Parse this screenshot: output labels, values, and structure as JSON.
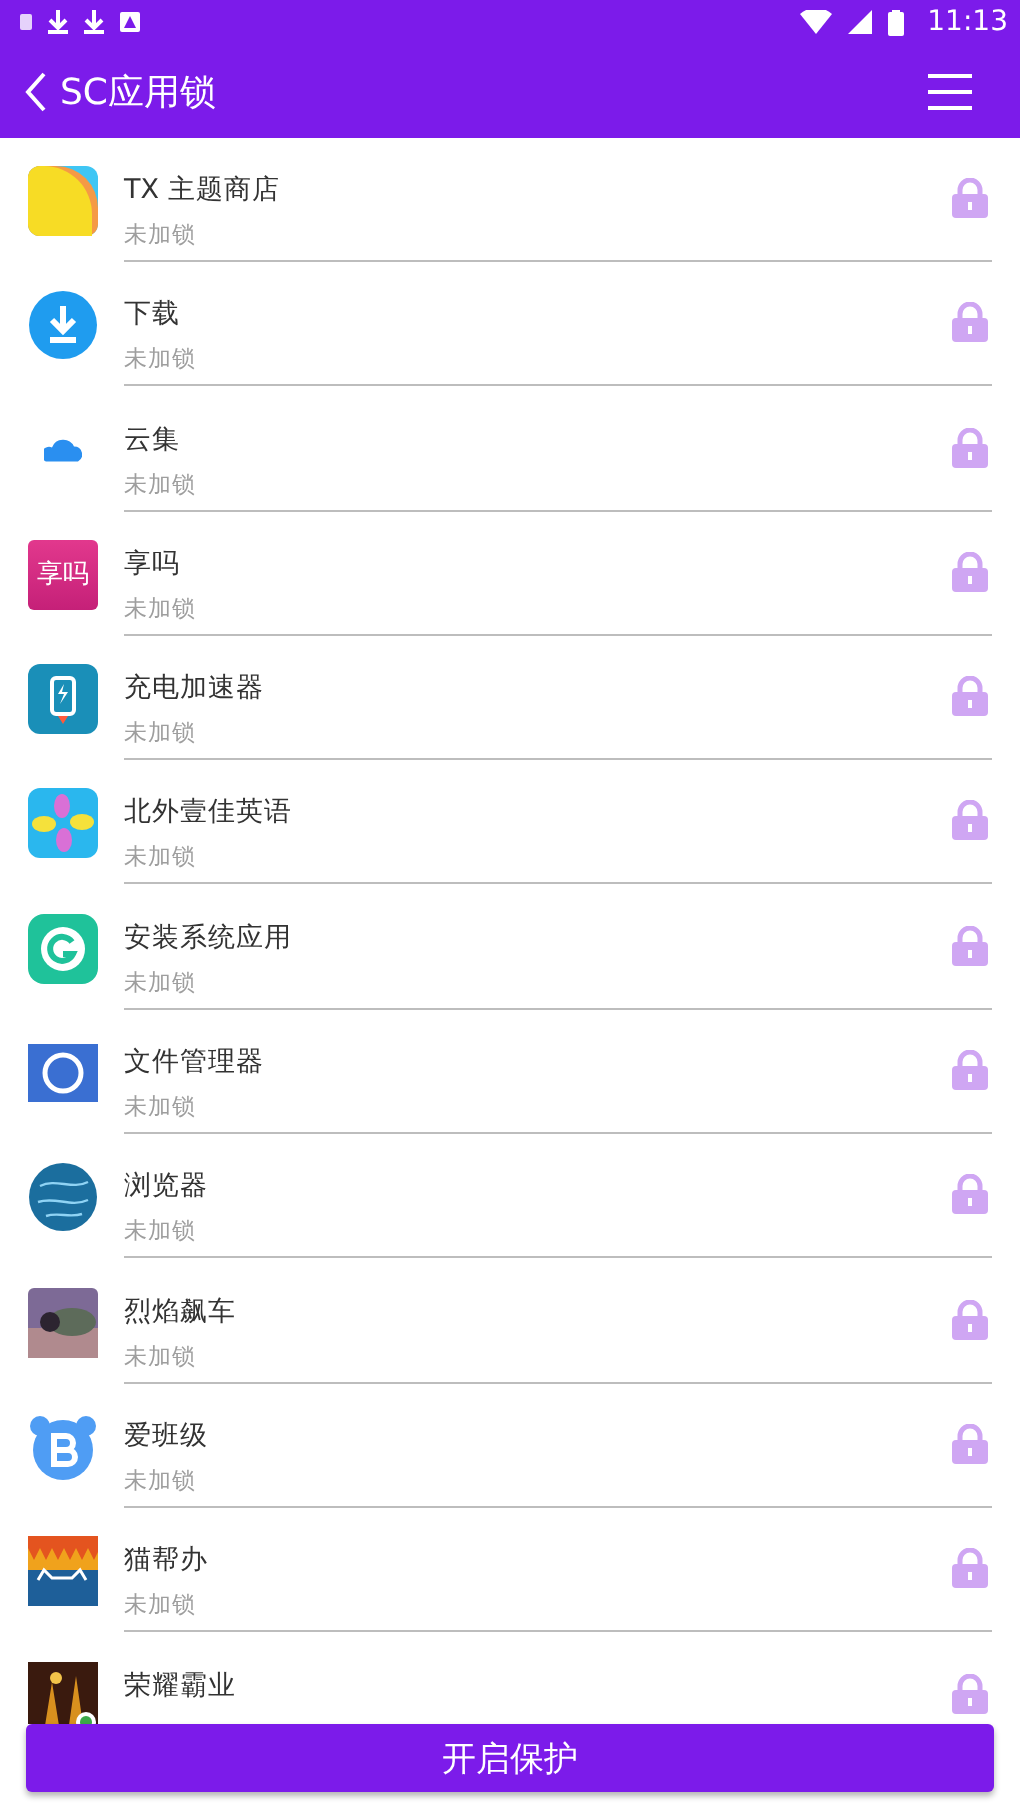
{
  "status_bar": {
    "time": "11:13"
  },
  "app_bar": {
    "title": "SC应用锁"
  },
  "apps": [
    {
      "name": "TX 主题商店",
      "status": "未加锁",
      "locked": false
    },
    {
      "name": "下载",
      "status": "未加锁",
      "locked": false
    },
    {
      "name": "云集",
      "status": "未加锁",
      "locked": false
    },
    {
      "name": "享吗",
      "status": "未加锁",
      "locked": false,
      "icon_text": "享吗"
    },
    {
      "name": "充电加速器",
      "status": "未加锁",
      "locked": false
    },
    {
      "name": "北外壹佳英语",
      "status": "未加锁",
      "locked": false
    },
    {
      "name": "安装系统应用",
      "status": "未加锁",
      "locked": false
    },
    {
      "name": "文件管理器",
      "status": "未加锁",
      "locked": false
    },
    {
      "name": "浏览器",
      "status": "未加锁",
      "locked": false
    },
    {
      "name": "烈焰飙车",
      "status": "未加锁",
      "locked": false
    },
    {
      "name": "爱班级",
      "status": "未加锁",
      "locked": false
    },
    {
      "name": "猫帮办",
      "status": "未加锁",
      "locked": false
    },
    {
      "name": "荣耀霸业",
      "locked": false
    }
  ],
  "primary_button": "开启保护"
}
